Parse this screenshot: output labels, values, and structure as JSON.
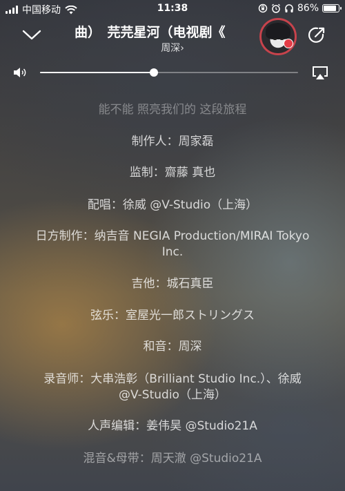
{
  "status_bar": {
    "carrier": "中国移动",
    "time": "11:38",
    "battery_percent": "86%",
    "battery_level": 0.86
  },
  "header": {
    "title": "曲）　芫芫星河（电视剧《",
    "artist": "周深",
    "artist_chevron": "›"
  },
  "volume": {
    "level": 0.44
  },
  "credits": [
    "能不能 照亮我们的 这段旅程",
    "制作人：周家磊",
    "监制：齋藤 真也",
    "配唱：徐威 @V-Studio（上海）",
    "日方制作：纳吉音 NEGIA Production/MIRAI Tokyo Inc.",
    "吉他：城石真臣",
    "弦乐：室屋光一郎ストリングス",
    "和音：周深",
    "录音师：大串浩彰（Brilliant Studio Inc.）、徐威 @V-Studio（上海）",
    "人声编辑：姜伟昊 @Studio21A",
    "混音&母带：周天澈 @Studio21A"
  ],
  "icons": {
    "collapse": "chevron-down-icon",
    "share": "share-icon",
    "volume": "speaker-icon",
    "airplay": "airplay-icon",
    "wifi": "wifi-icon",
    "alarm": "alarm-icon",
    "headphones": "headphones-icon",
    "lock_rotation": "rotation-lock-icon"
  }
}
